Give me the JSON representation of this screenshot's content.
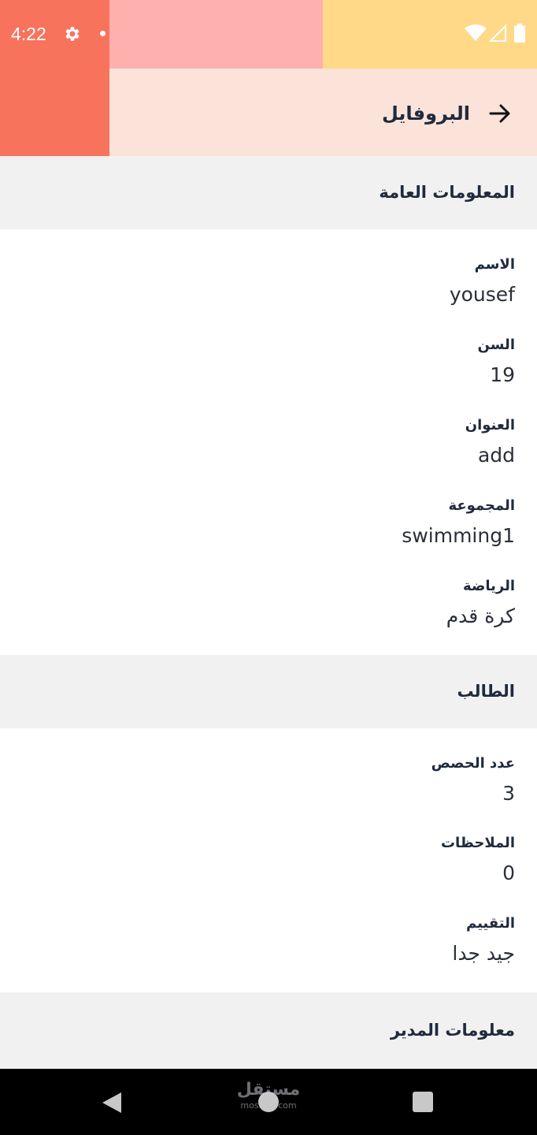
{
  "status_bar": {
    "time": "4:22",
    "icons": [
      "gear-icon",
      "notification-dot-icon",
      "wifi-icon",
      "signal-icon",
      "battery-icon"
    ]
  },
  "header": {
    "title": "البروفايل",
    "back_icon": "arrow-right-icon"
  },
  "sections": {
    "general": {
      "title": "المعلومات العامة",
      "fields": [
        {
          "label": "الاسم",
          "value": "yousef"
        },
        {
          "label": "السن",
          "value": "19"
        },
        {
          "label": "العنوان",
          "value": "add"
        },
        {
          "label": "المجموعة",
          "value": "swimming1"
        },
        {
          "label": "الرياضة",
          "value": "كرة قدم"
        }
      ]
    },
    "student": {
      "title": "الطالب",
      "fields": [
        {
          "label": "عدد الحصص",
          "value": "3"
        },
        {
          "label": "الملاحظات",
          "value": "0"
        },
        {
          "label": "التقييم",
          "value": "جيد جدا"
        }
      ]
    },
    "manager": {
      "title": "معلومات المدير"
    }
  },
  "watermark": {
    "arabic": "مستقل",
    "latin": "mostaql.com"
  },
  "colors": {
    "coral": "#f8735c",
    "pink": "#feb0ae",
    "yellow": "#ffd988",
    "peach": "#fbe3da",
    "section_bg": "#f1f1f1",
    "text": "#1f2a3d"
  }
}
